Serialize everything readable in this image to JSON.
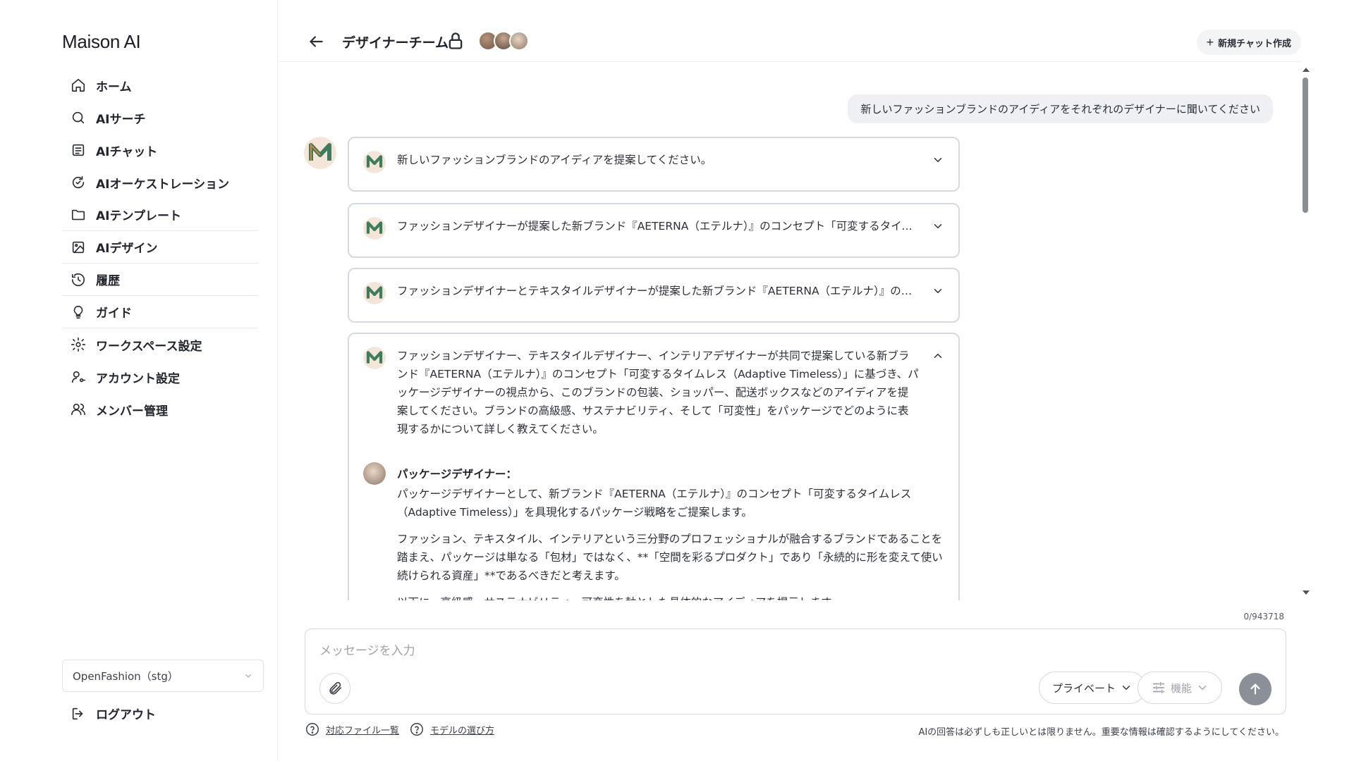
{
  "brand": {
    "name": "Maison AI"
  },
  "sidebar": {
    "items": [
      {
        "label": "ホーム",
        "icon": "home-icon"
      },
      {
        "label": "AIサーチ",
        "icon": "search-icon"
      },
      {
        "label": "AIチャット",
        "icon": "chat-icon"
      },
      {
        "label": "AIオーケストレーション",
        "icon": "orchestration-icon"
      },
      {
        "label": "AIテンプレート",
        "icon": "folder-icon"
      },
      {
        "label": "AIデザイン",
        "icon": "image-icon"
      },
      {
        "label": "履歴",
        "icon": "history-icon"
      },
      {
        "label": "ガイド",
        "icon": "lightbulb-icon"
      },
      {
        "label": "ワークスペース設定",
        "icon": "gear-icon"
      },
      {
        "label": "アカウント設定",
        "icon": "user-key-icon"
      },
      {
        "label": "メンバー管理",
        "icon": "users-icon"
      }
    ],
    "workspace": "OpenFashion（stg）",
    "logout": "ログアウト"
  },
  "header": {
    "title": "デザイナーチーム",
    "new_chat": "新規チャット作成"
  },
  "chat": {
    "user_message": "新しいファッションブランドのアイディアをそれぞれのデザイナーに聞いてください",
    "cards": [
      {
        "text": "新しいファッションブランドのアイディアを提案してください。"
      },
      {
        "text": "ファッションデザイナーが提案した新ブランド『AETERNA（エテルナ）』のコンセプト「可変するタイムレス」に基づき、テ..."
      },
      {
        "text": "ファッションデザイナーとテキスタイルデザイナーが提案した新ブランド『AETERNA（エテルナ）』のコンセプト「可変する..."
      },
      {
        "text": "ファッションデザイナー、テキスタイルデザイナー、インテリアデザイナーが共同で提案している新ブランド『AETERNA（エテルナ）』のコンセプト「可変するタイムレス（Adaptive Timeless）」に基づき、パッケージデザイナーの視点から、このブランドの包装、ショッパー、配送ボックスなどのアイディアを提案してください。ブランドの高級感、サステナビリティ、そして「可変性」をパッケージでどのように表現するかについて詳しく教えてください。"
      }
    ],
    "reply": {
      "name": "パッケージデザイナー：",
      "p1": "パッケージデザイナーとして、新ブランド『AETERNA（エテルナ）』のコンセプト「可変するタイムレス（Adaptive Timeless）」を具現化するパッケージ戦略をご提案します。",
      "p2": "ファッション、テキスタイル、インテリアという三分野のプロフェッショナルが融合するブランドであることを踏まえ、パッケージは単なる「包材」ではなく、**「空間を彩るプロダクト」であり「永続的に形を変えて使い続けられる資産」**であるべきだと考えます。",
      "p3": "以下に、高級感、サステナビリティ、可変性を軸とした具体的なアイディアを提示します。"
    }
  },
  "composer": {
    "counter": "0/943718",
    "placeholder": "メッセージを入力",
    "private_label": "プライベート",
    "function_label": "機能"
  },
  "footer": {
    "link1": "対応ファイル一覧",
    "link2": "モデルの選び方",
    "disclaimer": "AIの回答は必ずしも正しいとは限りません。重要な情報は確認するようにしてください。"
  }
}
